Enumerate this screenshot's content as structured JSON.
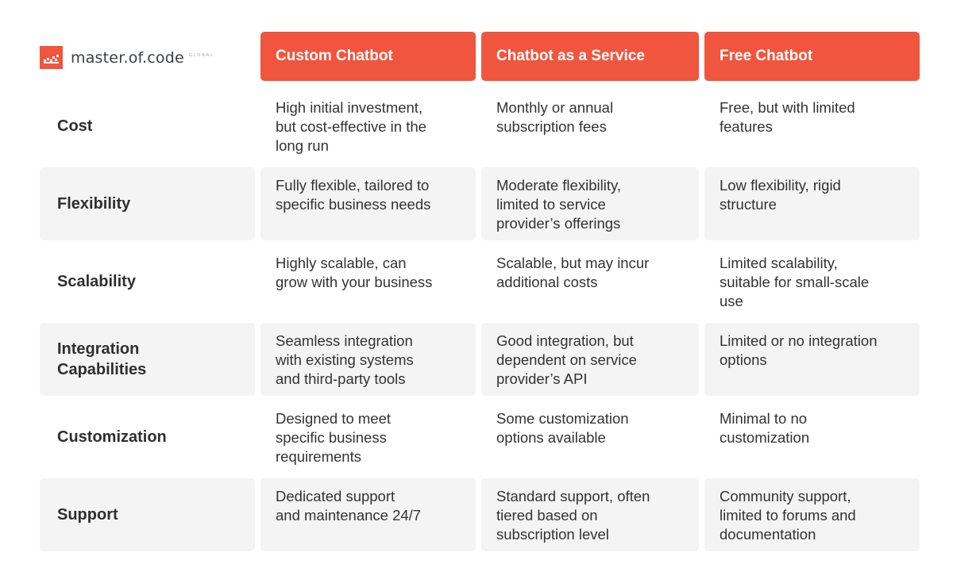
{
  "brand": {
    "name": "master.of.code",
    "suffix": "GLOBAL",
    "accent_color": "#f0553e"
  },
  "columns": [
    {
      "label": "Custom Chatbot"
    },
    {
      "label": "Chatbot as a Service"
    },
    {
      "label": "Free Chatbot"
    }
  ],
  "rows": [
    {
      "label": "Cost",
      "values": [
        "High initial investment,\nbut cost-effective in the\nlong run",
        "Monthly or annual\nsubscription fees",
        "Free, but with limited\nfeatures"
      ]
    },
    {
      "label": "Flexibility",
      "values": [
        "Fully flexible, tailored to\nspecific business needs",
        "Moderate flexibility,\nlimited to service\nprovider’s offerings",
        "Low flexibility, rigid\nstructure"
      ]
    },
    {
      "label": "Scalability",
      "values": [
        "Highly scalable, can\ngrow with your business",
        "Scalable, but may incur\nadditional costs",
        "Limited scalability,\nsuitable for small-scale\nuse"
      ]
    },
    {
      "label": "Integration\nCapabilities",
      "values": [
        "Seamless integration\nwith existing systems\nand third-party tools",
        "Good integration, but\ndependent on service\nprovider’s API",
        "Limited or no integration\noptions"
      ]
    },
    {
      "label": "Customization",
      "values": [
        "Designed to meet\nspecific business\nrequirements",
        "Some customization\noptions available",
        "Minimal to no\ncustomization"
      ]
    },
    {
      "label": "Support",
      "values": [
        "Dedicated support\nand maintenance 24/7",
        "Standard support, often\ntiered based on\nsubscription level",
        "Community support,\nlimited to forums and\ndocumentation"
      ]
    }
  ]
}
